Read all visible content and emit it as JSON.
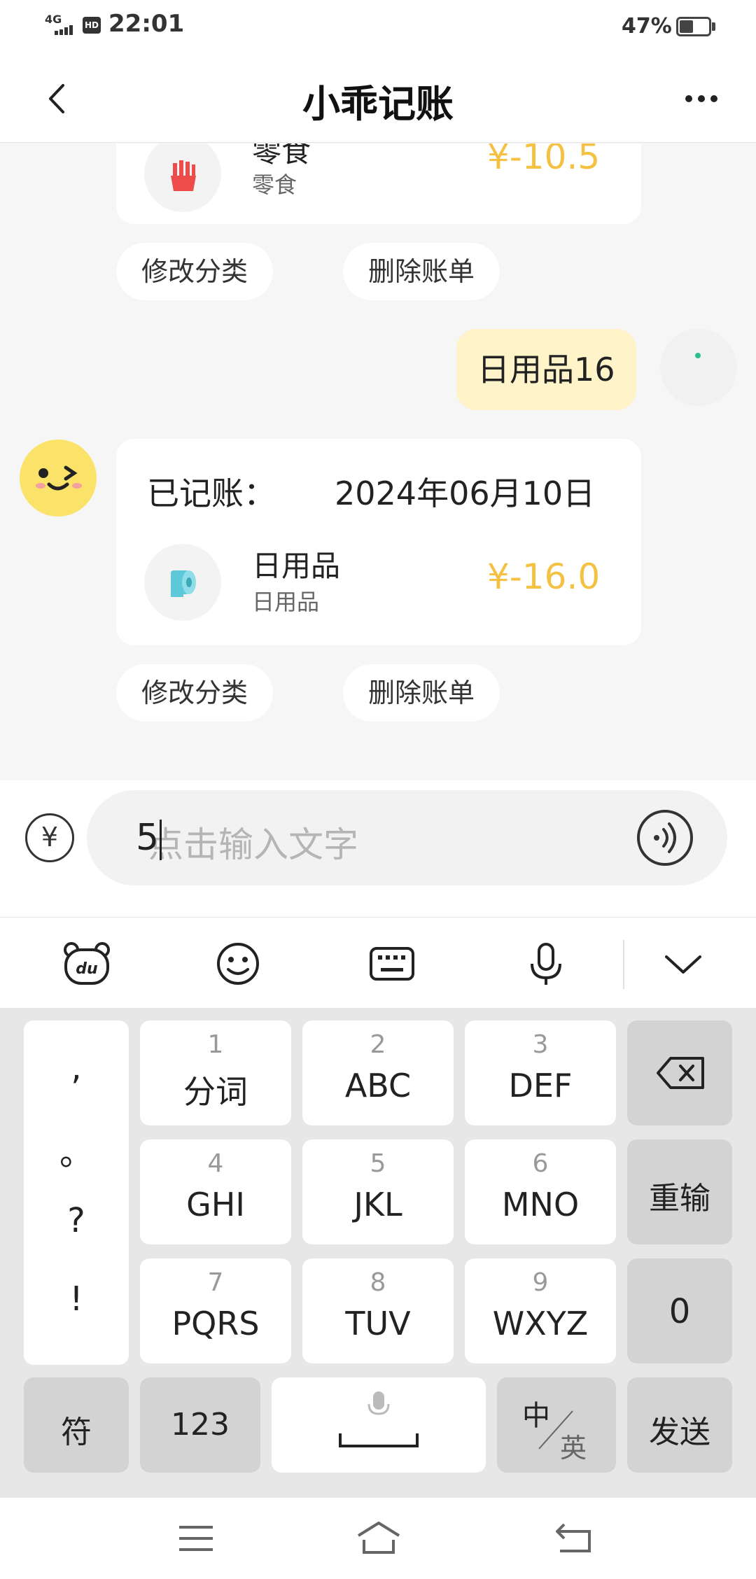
{
  "status_bar": {
    "network": "4G",
    "hd": "HD",
    "time": "22:01",
    "battery": "47%"
  },
  "nav": {
    "title": "小乖记账"
  },
  "chat": {
    "bill1": {
      "category_title": "零食",
      "category_sub": "零食",
      "amount": "¥-10.5"
    },
    "actions1": {
      "modify": "修改分类",
      "delete": "删除账单"
    },
    "user_message": "日用品16",
    "bill2": {
      "header_label": "已记账：",
      "date": "2024年06月10日",
      "category_title": "日用品",
      "category_sub": "日用品",
      "amount": "¥-16.0"
    },
    "actions2": {
      "modify": "修改分类",
      "delete": "删除账单"
    }
  },
  "input": {
    "value": "5",
    "placeholder": "点击输入文字",
    "yen_symbol": "¥"
  },
  "keyboard": {
    "punct": [
      ",",
      "。",
      "?",
      "!"
    ],
    "rows": [
      [
        {
          "num": "1",
          "label": "分词"
        },
        {
          "num": "2",
          "label": "ABC"
        },
        {
          "num": "3",
          "label": "DEF"
        }
      ],
      [
        {
          "num": "4",
          "label": "GHI"
        },
        {
          "num": "5",
          "label": "JKL"
        },
        {
          "num": "6",
          "label": "MNO"
        }
      ],
      [
        {
          "num": "7",
          "label": "PQRS"
        },
        {
          "num": "8",
          "label": "TUV"
        },
        {
          "num": "9",
          "label": "WXYZ"
        }
      ]
    ],
    "reenter": "重输",
    "zero": "0",
    "symbol": "符",
    "numbers": "123",
    "lang_cn": "中",
    "lang_en": "英",
    "send": "发送"
  },
  "colors": {
    "accent_amount": "#f5c143",
    "bubble": "#fff3c9",
    "avatar_bot": "#fbe36a"
  }
}
